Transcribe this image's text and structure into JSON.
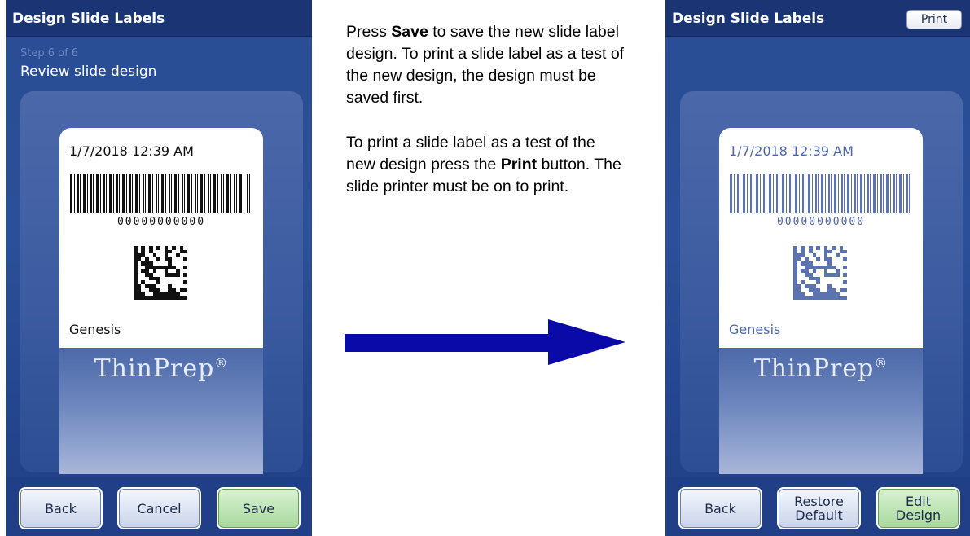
{
  "left_screen": {
    "title": "Design Slide Labels",
    "step": "Step 6 of 6",
    "step_title": "Review slide design",
    "label": {
      "date": "1/7/2018 12:39 AM",
      "barcode_number": "00000000000",
      "name": "Genesis",
      "brand": "ThinPrep",
      "brand_mark": "®"
    },
    "buttons": {
      "back": "Back",
      "cancel": "Cancel",
      "save": "Save"
    }
  },
  "instructions": {
    "p1_pre": "Press ",
    "p1_bold": "Save",
    "p1_post": " to save the new slide label design. To print a slide label as a test of the new design, the design must be saved first.",
    "p2_pre": "To print a slide label as a test of the new design press the ",
    "p2_bold": "Print",
    "p2_post": " button. The slide printer must be on to print."
  },
  "right_screen": {
    "title": "Design Slide Labels",
    "print_button": "Print",
    "label": {
      "date": "1/7/2018 12:39 AM",
      "barcode_number": "00000000000",
      "name": "Genesis",
      "brand": "ThinPrep",
      "brand_mark": "®"
    },
    "buttons": {
      "back": "Back",
      "restore_default": "Restore Default",
      "edit_design": "Edit Design"
    }
  },
  "colors": {
    "screen_blue": "#2b4f98",
    "title_bar": "#1b3473",
    "arrow": "#0a0aa8",
    "save_green": "#a9d99d"
  }
}
